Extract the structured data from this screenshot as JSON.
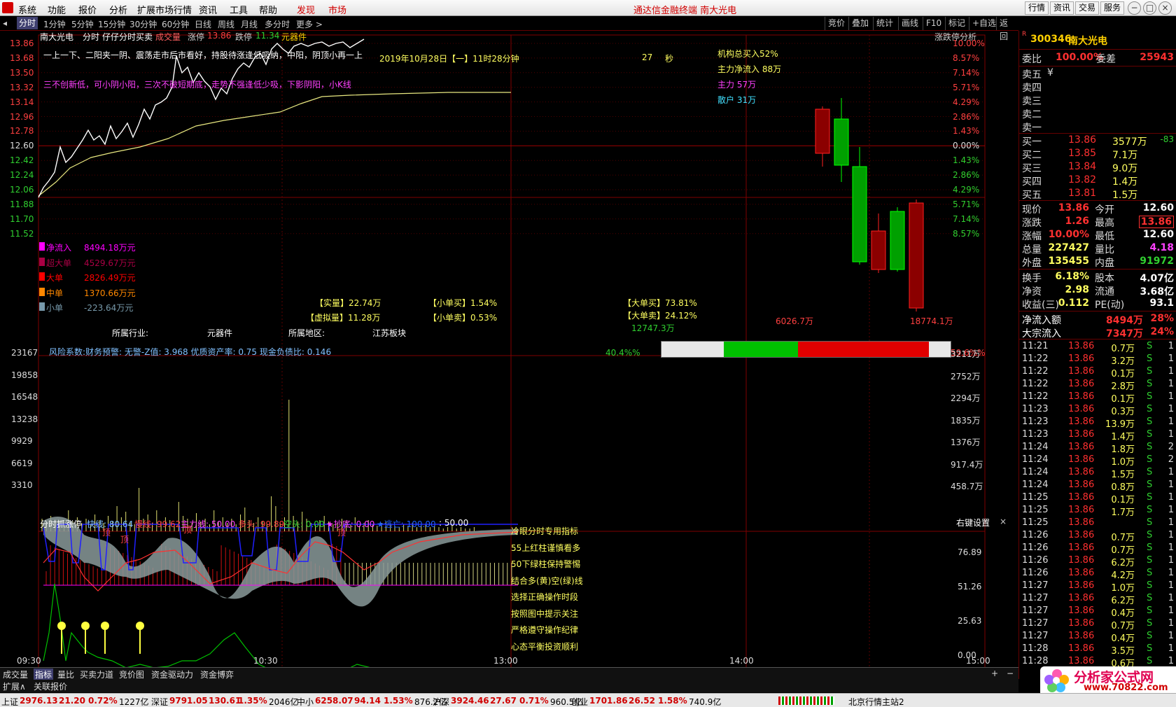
{
  "app": {
    "title": "通达信金融终端  南大光电",
    "menus": [
      "系统",
      "功能",
      "报价",
      "分析",
      "扩展市场行情",
      "资讯",
      "工具",
      "帮助",
      "发现",
      "市场"
    ],
    "right_buttons": [
      "行情",
      "资讯",
      "交易",
      "服务"
    ]
  },
  "tabs": {
    "items": [
      "分时",
      "1分钟",
      "5分钟",
      "15分钟",
      "30分钟",
      "60分钟",
      "日线",
      "周线",
      "月线",
      "多分时",
      "更多 >"
    ],
    "right": [
      "竞价",
      "叠加",
      "统计",
      "画线",
      "F10",
      "标记",
      "+自选",
      "返回"
    ]
  },
  "header": {
    "name": "南大光电",
    "mode": "分时",
    "sub": "仔仔分时买卖",
    "vol_label": "成交量",
    "zt_label": "涨停",
    "zt_val": "13.86",
    "dt_label": "跌停",
    "dt_val": "11.34",
    "sector": "元器件",
    "zdt": "涨跌停分析"
  },
  "price_axis": {
    "left": [
      "13.86",
      "13.68",
      "13.50",
      "13.32",
      "13.14",
      "12.96",
      "12.78",
      "12.60",
      "12.42",
      "12.24",
      "12.06",
      "11.88",
      "11.70",
      "11.52"
    ],
    "right": [
      "10.00%",
      "8.57%",
      "7.14%",
      "5.71%",
      "4.29%",
      "2.86%",
      "1.43%",
      "0.00%",
      "1.43%",
      "2.86%",
      "4.29%",
      "5.71%",
      "7.14%",
      "8.57%"
    ]
  },
  "overlay": {
    "line1": "一上一下、二阳夹一阴、震荡走市后市看好，持股待涨逢低吸纳，中阳，阴顶小再一上",
    "line2": "三不创新低，可小阴小阳，三次不破短期底，走势不强逢低少吸，下影阴阳，小K线",
    "datetime": "2019年10月28日【一】11时28分钟",
    "sec_val": "27",
    "sec_label": "秒",
    "inst_buy": "机构总买入52%",
    "main_net": "主力净流入 88万",
    "main": "主力 57万",
    "retail": "散户 31万",
    "flows": [
      {
        "label": "净流入",
        "val": "8494.18万元",
        "color": "#ff00ff"
      },
      {
        "label": "超大单",
        "val": "4529.67万元",
        "color": "#aa0044"
      },
      {
        "label": "大单",
        "val": "2826.49万元",
        "color": "#ff0000"
      },
      {
        "label": "中单",
        "val": "1370.66万元",
        "color": "#ff8800"
      },
      {
        "label": "小单",
        "val": "-223.64万元",
        "color": "#7799aa"
      }
    ],
    "shiliang": "【实量】22.74万",
    "xuni": "【虚拟量】11.28万",
    "xdm": "【小单买】1.54%",
    "xdmc": "【小单卖】0.53%",
    "ddm": "【大单买】73.81%",
    "ddmc": "【大单卖】24.12%",
    "industry_l": "所属行业:",
    "industry": "元器件",
    "region_l": "所属地区:",
    "region": "江苏板块",
    "risk": "风险系数:财务预警: 无警-Z值: 3.968 优质资产率: 0.75 现金负债比: 0.146",
    "bar_left": "12747.3万",
    "bar_mid": "6026.7万",
    "bar_right": "18774.1万",
    "pct_left": "40.4%%",
    "pct_right": "59.6%%"
  },
  "vol_axis": {
    "left": [
      "23167",
      "19858",
      "16548",
      "13238",
      "9929",
      "6619",
      "3310"
    ],
    "right": [
      "3211万",
      "2752万",
      "2294万",
      "1835万",
      "1376万",
      "917.4万",
      "458.7万"
    ]
  },
  "indicator": {
    "title": "分时抓涨停",
    "kx": "快线: 80.64",
    "mx": "慢线: 99.62",
    "zl": "主力线: 50.00",
    "dt": "多头: 99.89",
    "kt": "空头: 0.00",
    "cd": "★抄底: 0.00",
    "tw": "★逃亡: 100.00",
    "fifty": ": 50.00",
    "setting": "右键设置",
    "axis": [
      "76.89",
      "51.26",
      "25.63",
      "0.00"
    ],
    "ding": "顶",
    "notes": [
      "冷眼分时专用指标",
      "55上红柱谨慎看多",
      "50下绿柱保持警惕",
      "结合多(黄)空(绿)线",
      "选择正确操作时段",
      "按照图中提示关注",
      "严格遵守操作纪律",
      "心态平衡投资顺利"
    ]
  },
  "time_axis": [
    "09:30",
    "10:30",
    "13:00",
    "14:00",
    "15:00"
  ],
  "bottom_tabs": [
    "成交量",
    "指标",
    "量比",
    "买卖力道",
    "竞价图",
    "资金驱动力",
    "资金博弈"
  ],
  "ext_tabs": [
    "扩展∧",
    "关联报价"
  ],
  "quote": {
    "code": "300346",
    "name": "南大光电",
    "weibi_l": "委比",
    "weibi": "100.00%",
    "weicha_l": "委差",
    "weicha": "25943",
    "sells": [
      "卖五",
      "卖四",
      "卖三",
      "卖二",
      "卖一"
    ],
    "sell_extra": "¥",
    "buys": [
      {
        "l": "买一",
        "p": "13.86",
        "v": "3577万",
        "c": "-83"
      },
      {
        "l": "买二",
        "p": "13.85",
        "v": "7.1万",
        "c": ""
      },
      {
        "l": "买三",
        "p": "13.84",
        "v": "9.0万",
        "c": ""
      },
      {
        "l": "买四",
        "p": "13.82",
        "v": "1.4万",
        "c": ""
      },
      {
        "l": "买五",
        "p": "13.81",
        "v": "1.5万",
        "c": ""
      }
    ],
    "stats": [
      [
        "现价",
        "13.86",
        "今开",
        "12.60"
      ],
      [
        "涨跌",
        "1.26",
        "最高",
        "13.86"
      ],
      [
        "涨幅",
        "10.00%",
        "最低",
        "12.60"
      ],
      [
        "总量",
        "227427",
        "量比",
        "4.18"
      ],
      [
        "外盘",
        "135455",
        "内盘",
        "91972"
      ]
    ],
    "stats2": [
      [
        "换手",
        "6.18%",
        "股本",
        "4.07亿"
      ],
      [
        "净资",
        "2.98",
        "流通",
        "3.68亿"
      ],
      [
        "收益(三)",
        "0.112",
        "PE(动)",
        "93.1"
      ]
    ],
    "flow": [
      [
        "净流入额",
        "8494万",
        "28%"
      ],
      [
        "大宗流入",
        "7347万",
        "24%"
      ]
    ]
  },
  "ticks": [
    [
      "11:21",
      "13.86",
      "0.7万",
      "S",
      "1"
    ],
    [
      "11:22",
      "13.86",
      "3.2万",
      "S",
      "1"
    ],
    [
      "11:22",
      "13.86",
      "0.1万",
      "S",
      "1"
    ],
    [
      "11:22",
      "13.86",
      "2.8万",
      "S",
      "1"
    ],
    [
      "11:22",
      "13.86",
      "0.1万",
      "S",
      "1"
    ],
    [
      "11:23",
      "13.86",
      "0.3万",
      "S",
      "1"
    ],
    [
      "11:23",
      "13.86",
      "13.9万",
      "S",
      "1"
    ],
    [
      "11:23",
      "13.86",
      "1.4万",
      "S",
      "1"
    ],
    [
      "11:24",
      "13.86",
      "1.8万",
      "S",
      "2"
    ],
    [
      "11:24",
      "13.86",
      "1.0万",
      "S",
      "2"
    ],
    [
      "11:24",
      "13.86",
      "1.5万",
      "S",
      "1"
    ],
    [
      "11:24",
      "13.86",
      "0.8万",
      "S",
      "1"
    ],
    [
      "11:25",
      "13.86",
      "0.1万",
      "S",
      "1"
    ],
    [
      "11:25",
      "13.86",
      "1.7万",
      "S",
      "1"
    ],
    [
      "11:25",
      "13.86",
      "",
      "S",
      "1"
    ],
    [
      "11:26",
      "13.86",
      "0.7万",
      "S",
      "1"
    ],
    [
      "11:26",
      "13.86",
      "0.7万",
      "S",
      "1"
    ],
    [
      "11:26",
      "13.86",
      "6.2万",
      "S",
      "1"
    ],
    [
      "11:26",
      "13.86",
      "4.2万",
      "S",
      "1"
    ],
    [
      "11:27",
      "13.86",
      "1.0万",
      "S",
      "1"
    ],
    [
      "11:27",
      "13.86",
      "6.2万",
      "S",
      "1"
    ],
    [
      "11:27",
      "13.86",
      "0.4万",
      "S",
      "1"
    ],
    [
      "11:27",
      "13.86",
      "0.7万",
      "S",
      "1"
    ],
    [
      "11:27",
      "13.86",
      "0.4万",
      "S",
      "1"
    ],
    [
      "11:28",
      "13.86",
      "3.5万",
      "S",
      "1"
    ],
    [
      "11:28",
      "13.86",
      "0.6万",
      "S",
      "1"
    ]
  ],
  "status": [
    {
      "n": "上证",
      "v": "2976.13",
      "c": "21.20",
      "p": "0.72%",
      "a": "1227亿"
    },
    {
      "n": "深证",
      "v": "9791.05",
      "c": "130.61",
      "p": "1.35%",
      "a": "2046亿"
    },
    {
      "n": "中小",
      "v": "6258.07",
      "c": "94.14",
      "p": "1.53%",
      "a": "876.2亿"
    },
    {
      "n": "沪深",
      "v": "3924.46",
      "c": "27.67",
      "p": "0.71%",
      "a": "960.5亿"
    },
    {
      "n": "创业",
      "v": "1701.86",
      "c": "26.52",
      "p": "1.58%",
      "a": "740.9亿"
    }
  ],
  "status_station": "北京行情主站2",
  "watermark": {
    "brand": "分析家公式网",
    "url": "www.70822.com"
  },
  "colors": {
    "up": "#ff3333",
    "down": "#00cc00",
    "flat": "#ffffff",
    "avg": "#ffff66"
  }
}
